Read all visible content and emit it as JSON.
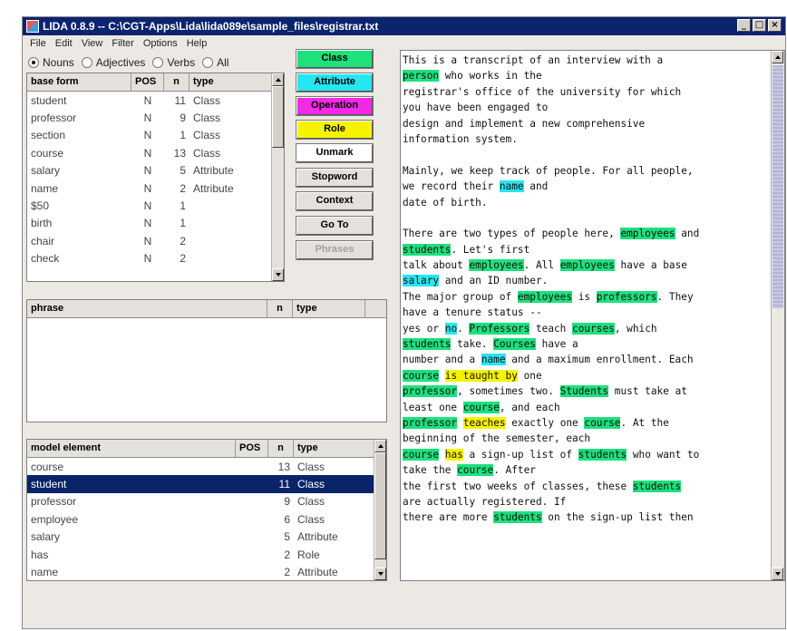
{
  "window": {
    "title": "LIDA 0.8.9  -- C:\\CGT-Apps\\Lida\\lida089e\\sample_files\\registrar.txt",
    "controls": [
      "minimize-icon",
      "maximize-icon",
      "close-icon"
    ]
  },
  "menu": [
    "File",
    "Edit",
    "View",
    "Filter",
    "Options",
    "Help"
  ],
  "filter": {
    "options": [
      "Nouns",
      "Adjectives",
      "Verbs",
      "All"
    ],
    "selected": "Nouns"
  },
  "words_table": {
    "headers": [
      "base form",
      "POS",
      "n",
      "type"
    ],
    "rows": [
      {
        "base": "student",
        "pos": "N",
        "n": "11",
        "type": "Class"
      },
      {
        "base": "professor",
        "pos": "N",
        "n": "9",
        "type": "Class"
      },
      {
        "base": "section",
        "pos": "N",
        "n": "1",
        "type": "Class"
      },
      {
        "base": "course",
        "pos": "N",
        "n": "13",
        "type": "Class"
      },
      {
        "base": "salary",
        "pos": "N",
        "n": "5",
        "type": "Attribute"
      },
      {
        "base": "name",
        "pos": "N",
        "n": "2",
        "type": "Attribute"
      },
      {
        "base": "$50",
        "pos": "N",
        "n": "1",
        "type": ""
      },
      {
        "base": "birth",
        "pos": "N",
        "n": "1",
        "type": ""
      },
      {
        "base": "chair",
        "pos": "N",
        "n": "2",
        "type": ""
      },
      {
        "base": "check",
        "pos": "N",
        "n": "2",
        "type": ""
      }
    ]
  },
  "phrase_table": {
    "headers": [
      "phrase",
      "n",
      "type"
    ]
  },
  "model_table": {
    "headers": [
      "model element",
      "POS",
      "n",
      "type"
    ],
    "rows": [
      {
        "name": "course",
        "pos": "",
        "n": "13",
        "type": "Class"
      },
      {
        "name": "student",
        "pos": "",
        "n": "11",
        "type": "Class",
        "selected": true
      },
      {
        "name": "professor",
        "pos": "",
        "n": "9",
        "type": "Class"
      },
      {
        "name": "employee",
        "pos": "",
        "n": "6",
        "type": "Class"
      },
      {
        "name": "salary",
        "pos": "",
        "n": "5",
        "type": "Attribute"
      },
      {
        "name": "has",
        "pos": "",
        "n": "2",
        "type": "Role"
      },
      {
        "name": "name",
        "pos": "",
        "n": "2",
        "type": "Attribute"
      }
    ]
  },
  "buttons": [
    {
      "name": "class",
      "label": "Class",
      "color": "#1ee07d"
    },
    {
      "name": "attribute",
      "label": "Attribute",
      "color": "#26e6f2"
    },
    {
      "name": "operation",
      "label": "Operation",
      "color": "#f229e6"
    },
    {
      "name": "role",
      "label": "Role",
      "color": "#f6f300"
    },
    {
      "name": "unmark",
      "label": "Unmark",
      "color": "#ffffff"
    },
    {
      "name": "stopword",
      "label": "Stopword",
      "color": "#e4e1dc"
    },
    {
      "name": "context",
      "label": "Context",
      "color": "#e4e1dc"
    },
    {
      "name": "go-to",
      "label": "Go To",
      "color": "#e4e1dc"
    },
    {
      "name": "phrases",
      "label": "Phrases",
      "color": "#e4e1dc",
      "disabled": true
    }
  ],
  "highlight_colors": {
    "class": "#1ee07d",
    "attribute": "#26e6f2",
    "role": "#f6f300"
  },
  "text_lines": [
    [
      [
        "This is a transcript of an interview with a",
        ""
      ]
    ],
    [
      [
        "person",
        "class"
      ],
      [
        " who works in the",
        ""
      ]
    ],
    [
      [
        "registrar's office of the university for which",
        ""
      ]
    ],
    [
      [
        "you have been engaged to",
        ""
      ]
    ],
    [
      [
        "design and implement a new comprehensive",
        ""
      ]
    ],
    [
      [
        "information system.",
        ""
      ]
    ],
    [
      [
        "",
        ""
      ]
    ],
    [
      [
        "Mainly, we keep track of people. For all people,",
        ""
      ]
    ],
    [
      [
        "we record their ",
        ""
      ],
      [
        "name",
        "attribute"
      ],
      [
        " and",
        ""
      ]
    ],
    [
      [
        "date of birth.",
        ""
      ]
    ],
    [
      [
        "",
        ""
      ]
    ],
    [
      [
        "There are two types of people here, ",
        ""
      ],
      [
        "employees",
        "class"
      ],
      [
        " and",
        ""
      ]
    ],
    [
      [
        "students",
        "class"
      ],
      [
        ". Let's first",
        ""
      ]
    ],
    [
      [
        "talk about ",
        ""
      ],
      [
        "employees",
        "class"
      ],
      [
        ". All ",
        ""
      ],
      [
        "employees",
        "class"
      ],
      [
        " have a base",
        ""
      ]
    ],
    [
      [
        "salary",
        "attribute"
      ],
      [
        " and an ID number.",
        ""
      ]
    ],
    [
      [
        "The major group of ",
        ""
      ],
      [
        "employees",
        "class"
      ],
      [
        " is ",
        ""
      ],
      [
        "professors",
        "class"
      ],
      [
        ". They",
        ""
      ]
    ],
    [
      [
        "have a tenure status --",
        ""
      ]
    ],
    [
      [
        "yes or ",
        ""
      ],
      [
        "no",
        "attribute"
      ],
      [
        ". ",
        ""
      ],
      [
        "Professors",
        "class"
      ],
      [
        " teach ",
        ""
      ],
      [
        "courses",
        "class"
      ],
      [
        ", which",
        ""
      ]
    ],
    [
      [
        "students",
        "class"
      ],
      [
        " take. ",
        ""
      ],
      [
        "Courses",
        "class"
      ],
      [
        " have a",
        ""
      ]
    ],
    [
      [
        "number and a ",
        ""
      ],
      [
        "name",
        "attribute"
      ],
      [
        " and a maximum enrollment. Each",
        ""
      ]
    ],
    [
      [
        "course",
        "class"
      ],
      [
        " ",
        ""
      ],
      [
        "is taught by",
        "role"
      ],
      [
        " one",
        ""
      ]
    ],
    [
      [
        "professor",
        "class"
      ],
      [
        ", sometimes two. ",
        ""
      ],
      [
        "Students",
        "class"
      ],
      [
        " must take at",
        ""
      ]
    ],
    [
      [
        "least one ",
        ""
      ],
      [
        "course",
        "class"
      ],
      [
        ", and each",
        ""
      ]
    ],
    [
      [
        "professor",
        "class"
      ],
      [
        " ",
        ""
      ],
      [
        "teaches",
        "role"
      ],
      [
        " exactly one ",
        ""
      ],
      [
        "course",
        "class"
      ],
      [
        ". At the",
        ""
      ]
    ],
    [
      [
        "beginning of the semester, each",
        ""
      ]
    ],
    [
      [
        "course",
        "class"
      ],
      [
        " ",
        ""
      ],
      [
        "has",
        "role"
      ],
      [
        " a sign-up list of ",
        ""
      ],
      [
        "students",
        "class"
      ],
      [
        " who want to",
        ""
      ]
    ],
    [
      [
        "take the ",
        ""
      ],
      [
        "course",
        "class"
      ],
      [
        ". After",
        ""
      ]
    ],
    [
      [
        "the first two weeks of classes, these ",
        ""
      ],
      [
        "students",
        "class"
      ],
      [
        " ",
        ""
      ]
    ],
    [
      [
        "are actually registered. If",
        ""
      ]
    ],
    [
      [
        "there are more ",
        ""
      ],
      [
        "students",
        "class"
      ],
      [
        " on the sign-up list then",
        ""
      ]
    ]
  ]
}
